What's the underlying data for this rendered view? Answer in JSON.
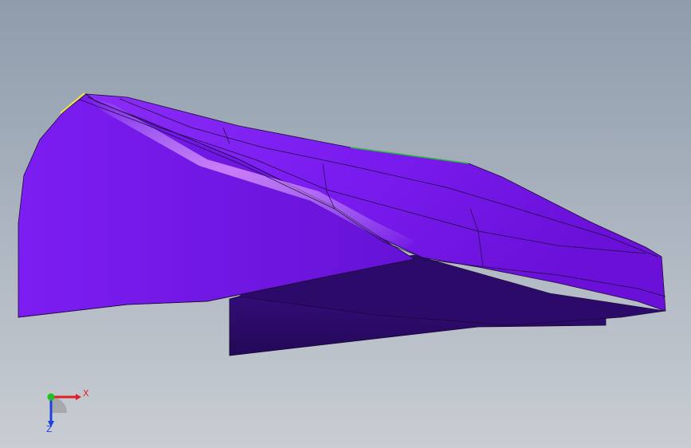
{
  "viewport": {
    "background_top": "#8e9cac",
    "background_bottom": "#c9cdd3"
  },
  "model": {
    "body_color": "#7a1cf0",
    "shadow_color": "#2d0a6e",
    "highlight_color": "#d37bff",
    "edge_color": "#1b0a3a",
    "selected_edge_yellow": "#f2e640",
    "selected_edge_green": "#2ab63a"
  },
  "triad": {
    "x_label": "X",
    "z_label": "Z",
    "x_color": "#e02020",
    "y_color": "#21c021",
    "z_color": "#2040e0"
  }
}
